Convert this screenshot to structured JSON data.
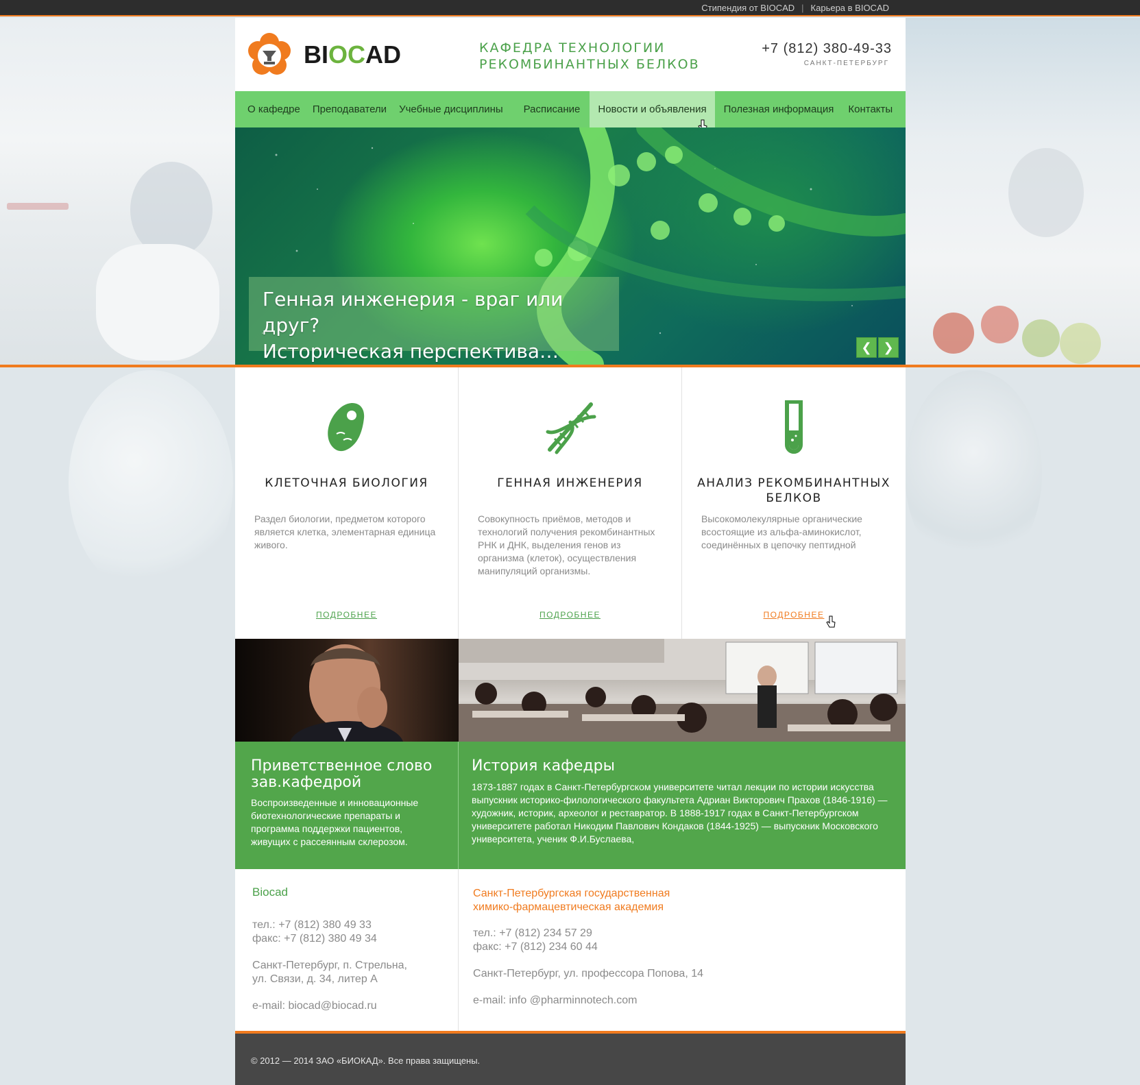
{
  "colors": {
    "accent_green": "#4ba14a",
    "nav_green": "#6fd06e",
    "orange": "#f07b1f",
    "dark": "#2d2d2d"
  },
  "topbar": {
    "links": [
      "Стипендия от BIOCAD",
      "Карьера в BIOCAD"
    ],
    "separator": "|"
  },
  "header": {
    "logo": {
      "brand_a": "BI",
      "brand_b": "OC",
      "brand_c": "AD",
      "icon": "flask-flower-logo-icon"
    },
    "department_line1": "КАФЕДРА ТЕХНОЛОГИИ",
    "department_line2": "РЕКОМБИНАНТНЫХ БЕЛКОВ",
    "phone": "+7 (812) 380-49-33",
    "city": "САНКТ-ПЕТЕРБУРГ"
  },
  "nav": {
    "items": [
      "О кафедре",
      "Преподаватели",
      "Учебные дисциплины",
      "Расписание",
      "Новости и объявления",
      "Полезная информация",
      "Контакты"
    ],
    "active_index": 4
  },
  "hero": {
    "caption_line1": "Генная инженерия - враг или друг?",
    "caption_line2": "Историческая перспектива…",
    "prev_icon": "chevron-left-icon",
    "next_icon": "chevron-right-icon",
    "prev_glyph": "❮",
    "next_glyph": "❯"
  },
  "features": [
    {
      "icon": "cell-icon",
      "title": "КЛЕТОЧНАЯ БИОЛОГИЯ",
      "text": "Раздел биологии, предметом которого является клетка, элементарная единица живого.",
      "more": "ПОДРОБНЕЕ"
    },
    {
      "icon": "dna-icon",
      "title": "ГЕННАЯ ИНЖЕНЕРИЯ",
      "text": "Совокупность приёмов, методов и технологий получения рекомбинантных РНК и ДНК, выделения генов из организма (клеток), осуществления манипуляций организмы.",
      "more": "ПОДРОБНЕЕ"
    },
    {
      "icon": "test-tube-icon",
      "title": "АНАЛИЗ РЕКОМБИНАНТНЫХ БЕЛКОВ",
      "text": "Высокомолекулярные органические всостоящие из альфа-аминокислот, соединённых в цепочку пептидной",
      "more": "ПОДРОБНЕЕ"
    }
  ],
  "promo": [
    {
      "title": "Приветственное слово зав.кафедрой",
      "text": "Воспроизведенные и инновационные биотехнологические препараты и программа поддержки пациентов, живущих с рассеянным склерозом."
    },
    {
      "title": "История кафедры",
      "text": "1873-1887 годах в Санкт-Петербургском университете читал лекции по истории искусства выпускник историко-филологического факультета Адриан Викторович Прахов (1846-1916) — художник, историк, археолог и реставратор. В 1888-1917 годах в Санкт-Петербургском университете работал Никодим Павлович Кондаков (1844-1925) — выпускник Московского университета, ученик Ф.И.Буслаева,"
    }
  ],
  "contacts": [
    {
      "title": "Biocad",
      "tel": "тел.: +7 (812) 380 49 33",
      "fax": "факс: +7 (812) 380 49 34",
      "address1": "Санкт-Петербург, п. Стрельна,",
      "address2": "ул. Связи, д. 34, литер А",
      "email": "e-mail: biocad@biocad.ru"
    },
    {
      "title1": "Санкт-Петербургская государственная",
      "title2": "химико-фармацевтическая академия",
      "tel": "тел.: +7 (812) 234 57 29",
      "fax": "факс: +7 (812) 234 60 44",
      "address": "Санкт-Петербург, ул. профессора Попова, 14",
      "email": "e-mail: info @pharminnotech.com"
    }
  ],
  "footer": {
    "copyright": "© 2012 — 2014 ЗАО «БИОКАД». Все права защищены."
  }
}
